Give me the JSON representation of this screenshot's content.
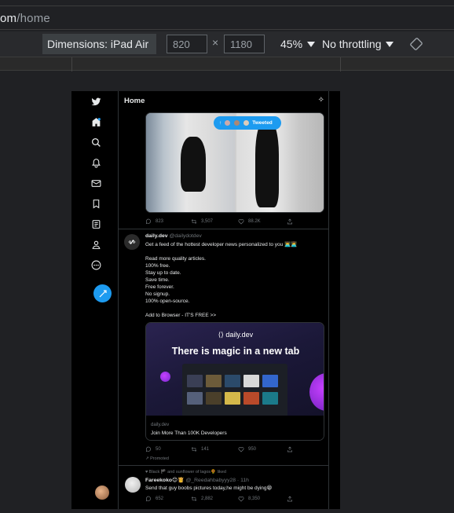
{
  "browser": {
    "url_host": "om",
    "url_path": "/home"
  },
  "device_toolbar": {
    "dimensions_label": "Dimensions: iPad Air",
    "width": "820",
    "height": "1180",
    "times": "×",
    "zoom": "45%",
    "throttling": "No throttling"
  },
  "twitter": {
    "header_title": "Home",
    "tweet1": {
      "pill_label": "Tweeted",
      "replies": "823",
      "retweets": "3,507",
      "likes": "88.2K"
    },
    "tweet2": {
      "name": "daily.dev",
      "handle": "@dailydotdev",
      "lines": [
        "Get a feed of the hottest developer news personalized to you 👨‍💻👩‍💻",
        "",
        "Read more quality articles.",
        "100% free.",
        "Stay up to date.",
        "Save time.",
        "Free forever.",
        "No signup.",
        "100% open-source.",
        "",
        "Add to Browser - IT'S FREE >>"
      ],
      "card_brand": "daily.dev",
      "card_headline": "There is magic in a new tab",
      "card_domain": "daily.dev",
      "card_title": "Join More Than 100K Developers",
      "replies": "50",
      "retweets": "141",
      "likes": "950",
      "promoted": "Promoted"
    },
    "tweet3": {
      "social_context": "Black 🏴 and sunflower of lagos🌻 liked",
      "name": "Fareekoko😊👸",
      "handle": "@_Reedahbabyyy28 · 11h",
      "text": "Send that guy boobs pictures today,he might be dying😁",
      "replies": "652",
      "retweets": "2,882",
      "likes": "8,350"
    }
  },
  "colors": {
    "accent": "#1d9bf0",
    "background": "#000000",
    "devtools": "#202124"
  }
}
